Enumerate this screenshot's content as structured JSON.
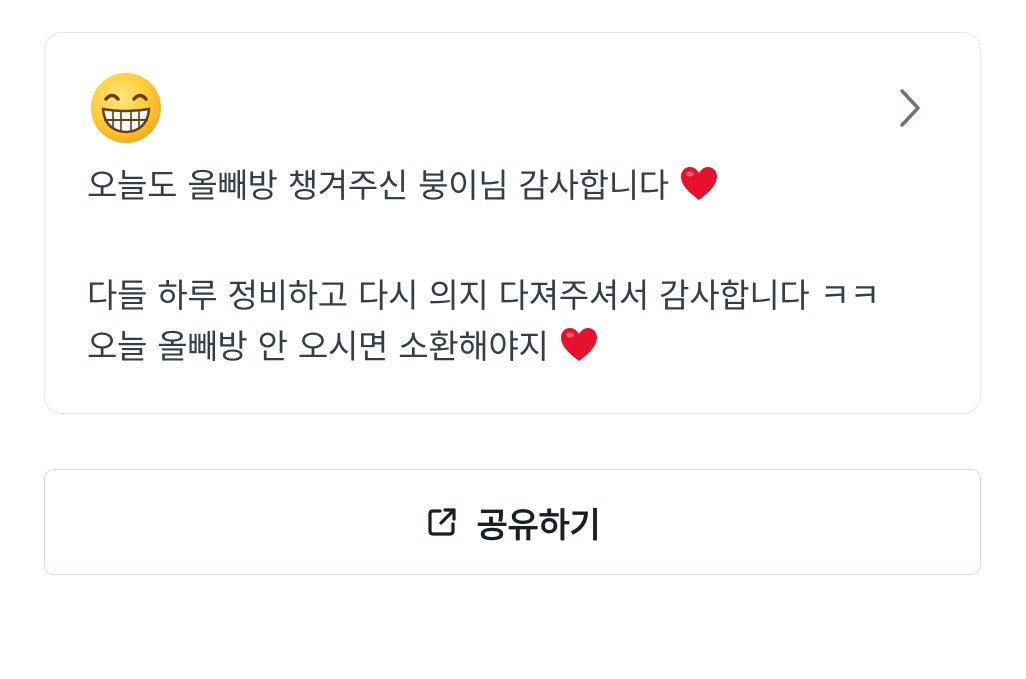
{
  "post": {
    "emoji_icon": "grinning-face-with-smiling-eyes-icon",
    "line1": "오늘도 올빼방 챙겨주신 붕이님 감사합니다",
    "line2": "다들 하루 정비하고 다시 의지 다져주셔서 감사합니다 ㅋㅋ",
    "line3": "오늘 올빼방 안 오시면 소환해야지",
    "heart_icon": "red-heart-icon",
    "heart_color": "#e8112d",
    "detail_icon": "chevron-right-icon"
  },
  "share": {
    "label": "공유하기",
    "icon": "external-link-icon"
  },
  "colors": {
    "text": "#333d4b",
    "button_text": "#191f28",
    "border": "#e6e8eb",
    "chevron": "#6b7684"
  }
}
